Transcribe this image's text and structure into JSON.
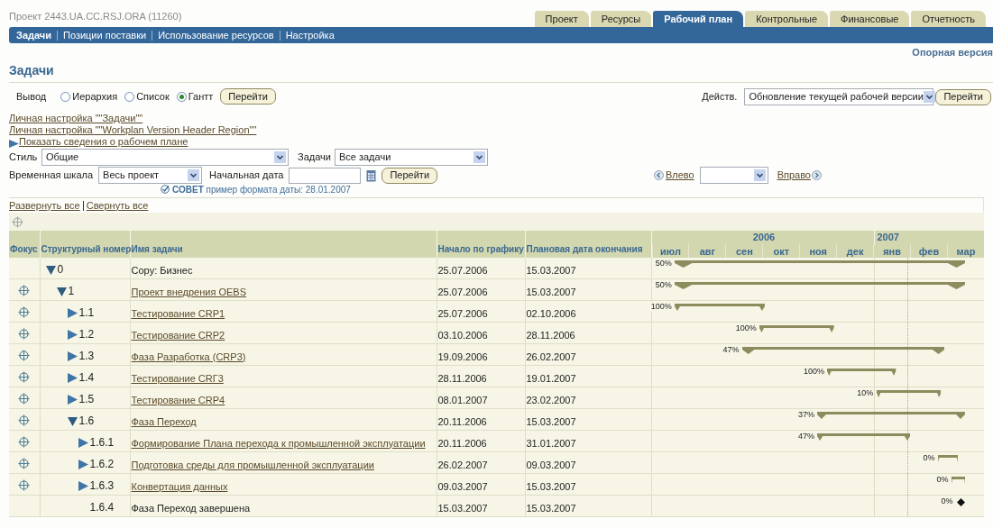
{
  "header": {
    "title": "Проект 2443.UA.CC.RSJ.ORA (11260)"
  },
  "tabs": [
    {
      "label": "Проект",
      "selected": false
    },
    {
      "label": "Ресурсы",
      "selected": false
    },
    {
      "label": "Рабочий план",
      "selected": true
    },
    {
      "label": "Контрольные",
      "selected": false
    },
    {
      "label": "Финансовые",
      "selected": false
    },
    {
      "label": "Отчетность",
      "selected": false
    }
  ],
  "subtabs": [
    {
      "label": "Задачи",
      "selected": true
    },
    {
      "label": "Позиции поставки",
      "selected": false
    },
    {
      "label": "Использование ресурсов",
      "selected": false
    },
    {
      "label": "Настройка",
      "selected": false
    }
  ],
  "baseline_link": "Опорная версия",
  "page_title": "Задачи",
  "view": {
    "label": "Вывод",
    "options": [
      {
        "label": "Иерархия",
        "selected": false
      },
      {
        "label": "Список",
        "selected": false
      },
      {
        "label": "Гантт",
        "selected": true
      }
    ],
    "go": "Перейти"
  },
  "actions": {
    "label": "Действ.",
    "value": "Обновление текущей рабочей версии",
    "go": "Перейти"
  },
  "personalize_links": [
    "Личная настройка \"\"Задачи\"\"",
    "Личная настройка \"\"Workplan Version Header Region\"\""
  ],
  "show_details": "Показать сведения о рабочем плане",
  "filters": {
    "style_label": "Стиль",
    "style_value": "Общие",
    "tasks_label": "Задачи",
    "tasks_value": "Все задачи",
    "scale_label": "Временная шкала",
    "scale_value": "Весь проект",
    "start_label": "Начальная дата",
    "go": "Перейти",
    "tip_label": "СОВЕТ",
    "tip_text": "пример формата даты: 28.01.2007"
  },
  "nav": {
    "left": "Влево",
    "right": "Вправо"
  },
  "expand_all": "Развернуть все",
  "collapse_all": "Свернуть все",
  "table": {
    "columns": [
      "Фокус",
      "Структурный номер",
      "Имя задачи",
      "Начало по графику",
      "Плановая дата окончания"
    ],
    "years": [
      "2006",
      "2007"
    ],
    "months": [
      "июл",
      "авг",
      "сен",
      "окт",
      "ноя",
      "дек",
      "янв",
      "фев",
      "мар"
    ],
    "rows": [
      {
        "number": "0",
        "name": "Copy: Бизнес",
        "link": false,
        "focus": false,
        "expanded": true,
        "start": "25.07.2006",
        "end": "15.03.2007",
        "percent": "50%",
        "kind": "bar",
        "children": [
          {
            "number": "1",
            "name": "Проект внедрения OEBS",
            "link": true,
            "focus": true,
            "expanded": true,
            "start": "25.07.2006",
            "end": "15.03.2007",
            "percent": "50%",
            "kind": "bar",
            "children": [
              {
                "number": "1.1",
                "name": "Тестирование CRP1",
                "link": true,
                "focus": true,
                "expanded": false,
                "start": "25.07.2006",
                "end": "02.10.2006",
                "percent": "100%",
                "kind": "bar"
              },
              {
                "number": "1.2",
                "name": "Тестирование CRP2",
                "link": true,
                "focus": true,
                "expanded": false,
                "start": "03.10.2006",
                "end": "28.11.2006",
                "percent": "100%",
                "kind": "bar"
              },
              {
                "number": "1.3",
                "name": "Фаза Разработка (CRP3)",
                "link": true,
                "focus": true,
                "expanded": false,
                "start": "19.09.2006",
                "end": "26.02.2007",
                "percent": "47%",
                "kind": "bar"
              },
              {
                "number": "1.4",
                "name": "Тестирование CRГ3",
                "link": true,
                "focus": true,
                "expanded": false,
                "start": "28.11.2006",
                "end": "19.01.2007",
                "percent": "100%",
                "kind": "bar"
              },
              {
                "number": "1.5",
                "name": "Тестирование CRP4",
                "link": true,
                "focus": true,
                "expanded": false,
                "start": "08.01.2007",
                "end": "23.02.2007",
                "percent": "10%",
                "kind": "bar"
              },
              {
                "number": "1.6",
                "name": "Фаза Переход",
                "link": true,
                "focus": true,
                "expanded": true,
                "start": "20.11.2006",
                "end": "15.03.2007",
                "percent": "37%",
                "kind": "bar",
                "children": [
                  {
                    "number": "1.6.1",
                    "name": "Формирование Плана перехода к промышленной эксплуатации",
                    "link": true,
                    "focus": true,
                    "expanded": false,
                    "start": "20.11.2006",
                    "end": "31.01.2007",
                    "percent": "47%",
                    "kind": "bar"
                  },
                  {
                    "number": "1.6.2",
                    "name": "Подготовка среды для промышленной эксплуатации",
                    "link": true,
                    "focus": true,
                    "expanded": false,
                    "start": "26.02.2007",
                    "end": "09.03.2007",
                    "percent": "0%",
                    "kind": "bar"
                  },
                  {
                    "number": "1.6.3",
                    "name": "Конвертация данных",
                    "link": true,
                    "focus": true,
                    "expanded": false,
                    "start": "09.03.2007",
                    "end": "15.03.2007",
                    "percent": "0%",
                    "kind": "bar"
                  },
                  {
                    "number": "1.6.4",
                    "name": "Фаза Переход завершена",
                    "link": false,
                    "focus": false,
                    "start": "15.03.2007",
                    "end": "15.03.2007",
                    "percent": "0%",
                    "kind": "milestone"
                  }
                ]
              }
            ]
          }
        ]
      }
    ]
  }
}
